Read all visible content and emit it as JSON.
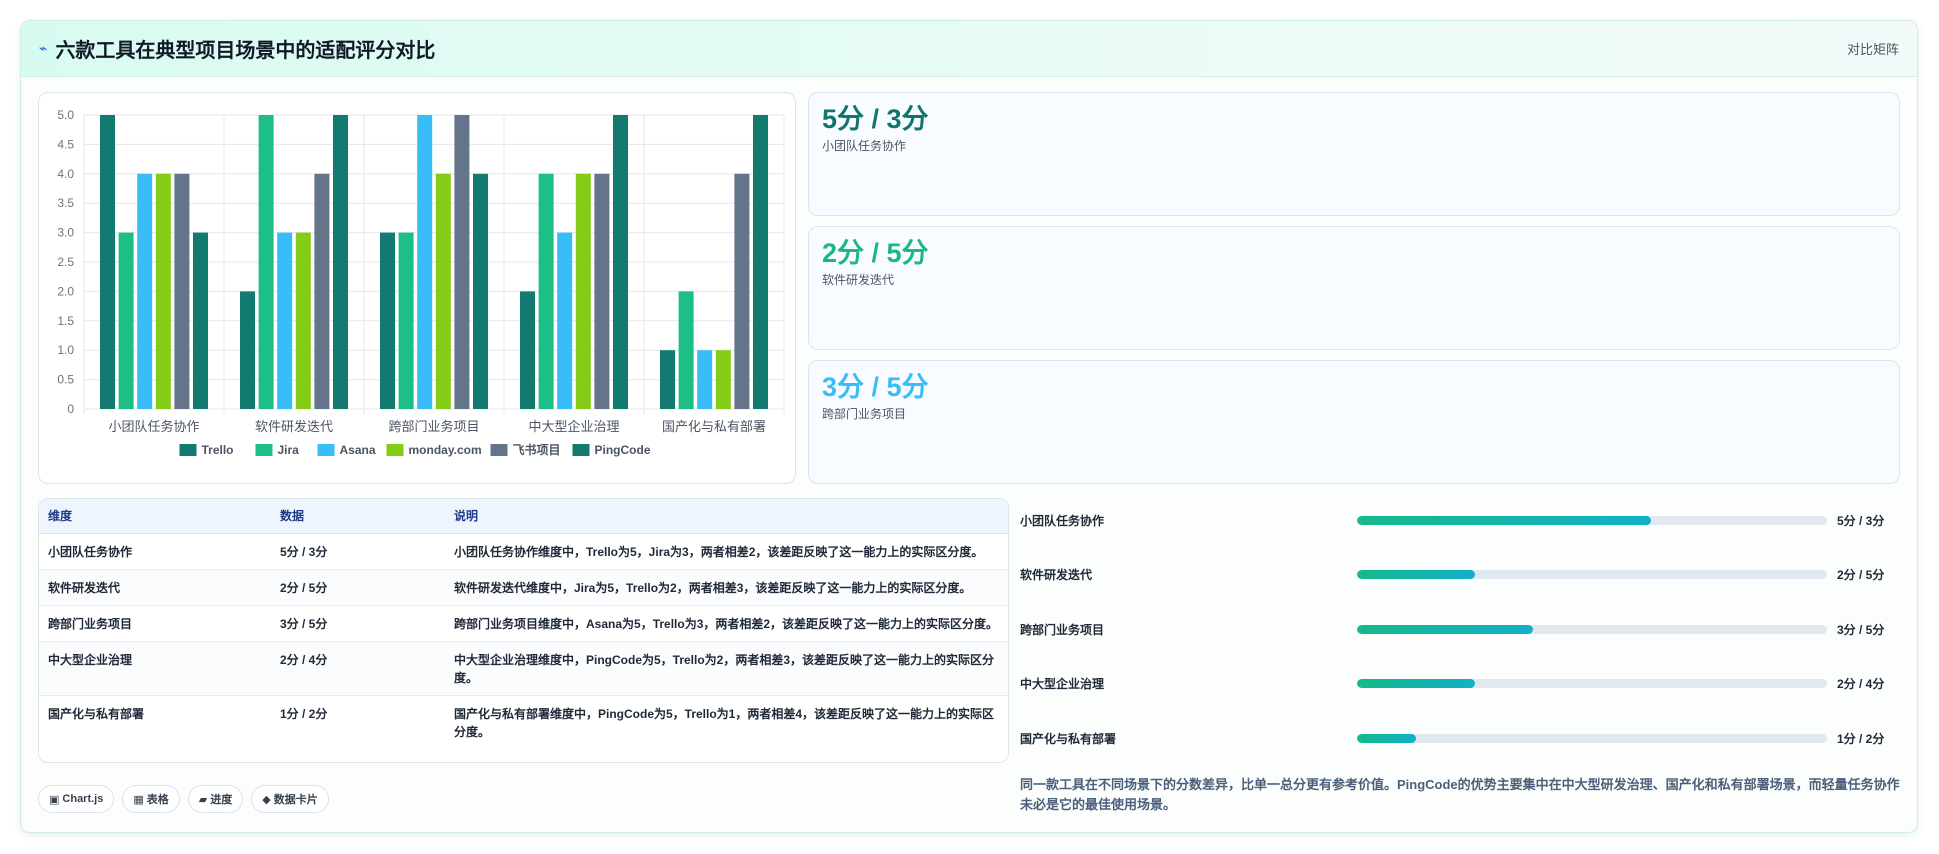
{
  "header": {
    "icon": "lightning-icon",
    "title": "六款工具在典型项目场景中的适配评分对比",
    "tag": "对比矩阵"
  },
  "chart_data": {
    "type": "bar",
    "categories": [
      "小团队任务协作",
      "软件研发迭代",
      "跨部门业务项目",
      "中大型企业治理",
      "国产化与私有部署"
    ],
    "series": [
      {
        "name": "Trello",
        "color": "#137a6f",
        "values": [
          5,
          2,
          3,
          2,
          1
        ]
      },
      {
        "name": "Jira",
        "color": "#1dbf86",
        "values": [
          3,
          5,
          3,
          4,
          2
        ]
      },
      {
        "name": "Asana",
        "color": "#38bdf8",
        "values": [
          4,
          3,
          5,
          3,
          1
        ]
      },
      {
        "name": "monday.com",
        "color": "#84cc16",
        "values": [
          4,
          3,
          4,
          4,
          1
        ]
      },
      {
        "name": "飞书项目",
        "color": "#64748b",
        "values": [
          4,
          4,
          5,
          4,
          4
        ]
      },
      {
        "name": "PingCode",
        "color": "#137a6f",
        "values": [
          3,
          5,
          4,
          5,
          5
        ]
      }
    ],
    "ylim": [
      0,
      5
    ],
    "yticks": [
      "0",
      "0.5",
      "1.0",
      "1.5",
      "2.0",
      "2.5",
      "3.0",
      "3.5",
      "4.0",
      "4.5",
      "5.0"
    ],
    "grid": true,
    "legend": "bottom"
  },
  "stats": [
    {
      "value": "5分 / 3分",
      "label": "小团队任务协作",
      "color": "#0f766e"
    },
    {
      "value": "2分 / 5分",
      "label": "软件研发迭代",
      "color": "#1db784"
    },
    {
      "value": "3分 / 5分",
      "label": "跨部门业务项目",
      "color": "#38bdf8"
    }
  ],
  "table": {
    "headers": [
      "维度",
      "数据",
      "说明"
    ],
    "rows": [
      [
        "小团队任务协作",
        "5分 / 3分",
        "小团队任务协作维度中，Trello为5，Jira为3，两者相差2，该差距反映了这一能力上的实际区分度。"
      ],
      [
        "软件研发迭代",
        "2分 / 5分",
        "软件研发迭代维度中，Jira为5，Trello为2，两者相差3，该差距反映了这一能力上的实际区分度。"
      ],
      [
        "跨部门业务项目",
        "3分 / 5分",
        "跨部门业务项目维度中，Asana为5，Trello为3，两者相差2，该差距反映了这一能力上的实际区分度。"
      ],
      [
        "中大型企业治理",
        "2分 / 4分",
        "中大型企业治理维度中，PingCode为5，Trello为2，两者相差3，该差距反映了这一能力上的实际区分度。"
      ],
      [
        "国产化与私有部署",
        "1分 / 2分",
        "国产化与私有部署维度中，PingCode为5，Trello为1，两者相差4，该差距反映了这一能力上的实际区分度。"
      ]
    ]
  },
  "progress": [
    {
      "label": "小团队任务协作",
      "value": "5分 / 3分",
      "fraction": 0.625
    },
    {
      "label": "软件研发迭代",
      "value": "2分 / 5分",
      "fraction": 0.25
    },
    {
      "label": "跨部门业务项目",
      "value": "3分 / 5分",
      "fraction": 0.375
    },
    {
      "label": "中大型企业治理",
      "value": "2分 / 4分",
      "fraction": 0.25
    },
    {
      "label": "国产化与私有部署",
      "value": "1分 / 2分",
      "fraction": 0.125
    }
  ],
  "note": "同一款工具在不同场景下的分数差异，比单一总分更有参考价值。PingCode的优势主要集中在中大型研发治理、国产化和私有部署场景，而轻量任务协作未必是它的最佳使用场景。",
  "chips": [
    {
      "icon": "▣",
      "icon_name": "chart-icon",
      "label": "Chart.js"
    },
    {
      "icon": "▦",
      "icon_name": "table-icon",
      "label": "表格"
    },
    {
      "icon": "▰",
      "icon_name": "progress-icon",
      "label": "进度"
    },
    {
      "icon": "◆",
      "icon_name": "card-icon",
      "label": "数据卡片"
    }
  ]
}
